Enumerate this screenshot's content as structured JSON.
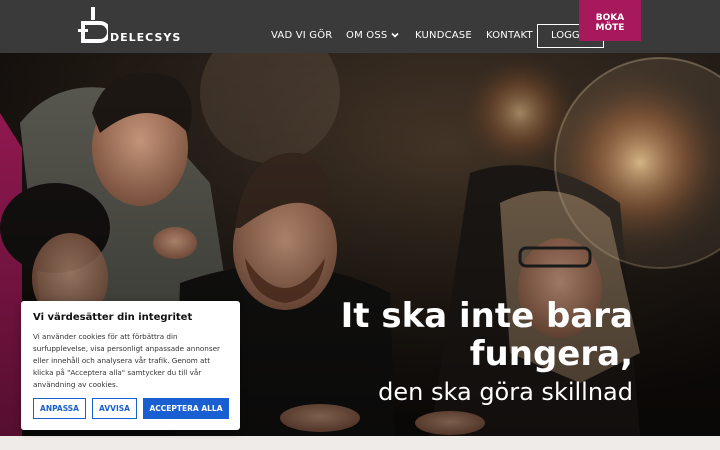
{
  "header": {
    "logo_text": "DELECSYS",
    "nav": [
      {
        "label": "VAD VI GÖR"
      },
      {
        "label": "OM OSS"
      },
      {
        "label": "KUNDCASE"
      },
      {
        "label": "KONTAKT"
      }
    ],
    "login_label": "LOGGA IN",
    "boka_line1": "BOKA",
    "boka_line2": "MÖTE",
    "colors": {
      "bar": "#3a3a3a",
      "accent": "#a8185c"
    }
  },
  "hero": {
    "headline_line1": "It ska inte bara",
    "headline_line2": "fungera,",
    "subline": "den ska göra skillnad"
  },
  "cookie": {
    "title": "Vi värdesätter din integritet",
    "text": "Vi använder cookies för att förbättra din surfupplevelse, visa personligt anpassade annonser eller innehåll och analysera vår trafik. Genom att klicka på \"Acceptera alla\" samtycker du till vår användning av cookies.",
    "buttons": {
      "customize": "ANPASSA",
      "reject": "AVVISA",
      "accept": "ACCEPTERA ALLA"
    },
    "colors": {
      "primary": "#1a5fd1"
    }
  }
}
